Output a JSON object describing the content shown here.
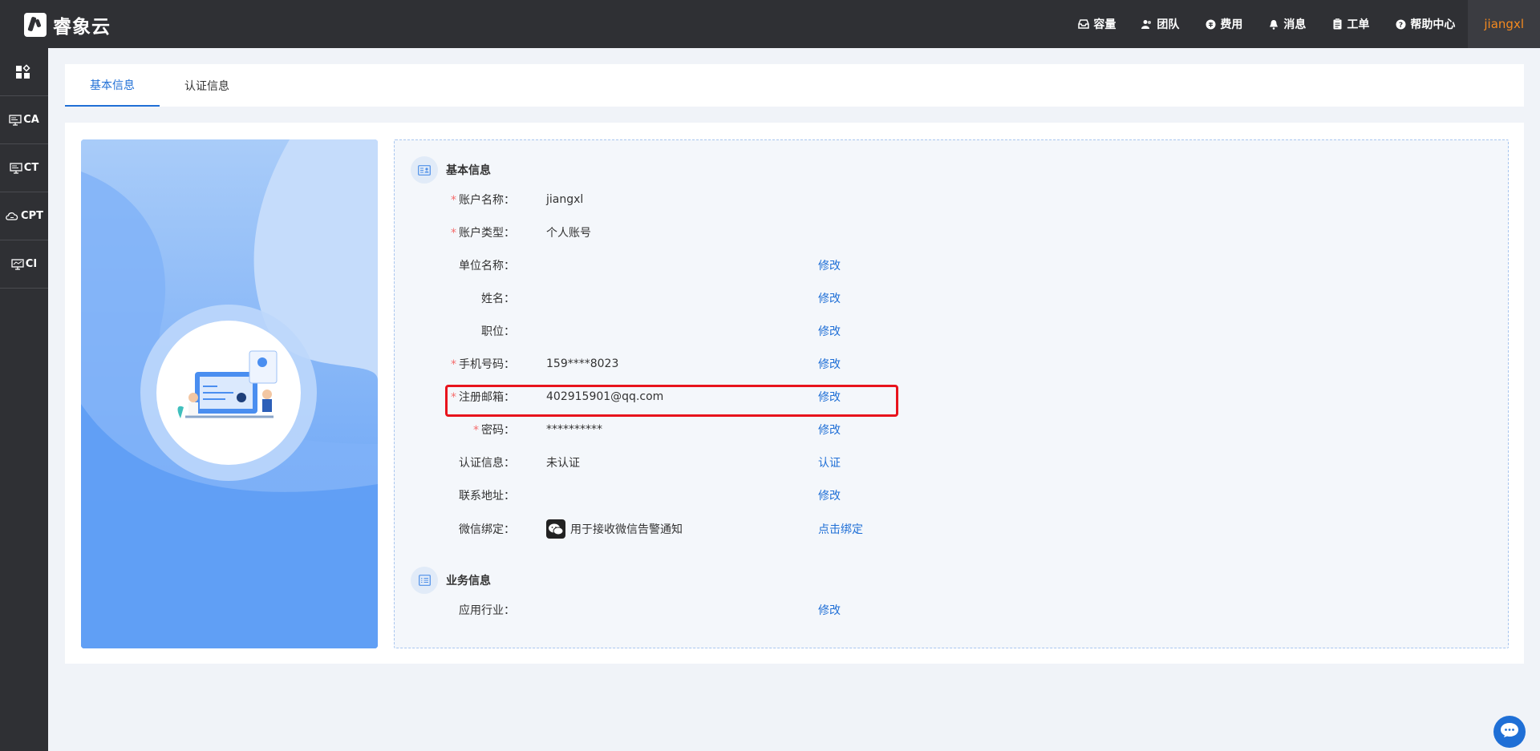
{
  "brand": {
    "name": "睿象云"
  },
  "topnav": {
    "items": [
      {
        "label": "容量",
        "icon": "inbox-icon"
      },
      {
        "label": "团队",
        "icon": "team-icon"
      },
      {
        "label": "费用",
        "icon": "currency-icon"
      },
      {
        "label": "消息",
        "icon": "bell-icon"
      },
      {
        "label": "工单",
        "icon": "clipboard-icon"
      },
      {
        "label": "帮助中心",
        "icon": "help-icon"
      }
    ],
    "user": "jiangxl"
  },
  "sidebar": {
    "items": [
      {
        "label": "",
        "icon": "dashboard-icon"
      },
      {
        "label": "CA",
        "icon": "monitor-icon"
      },
      {
        "label": "CT",
        "icon": "monitor-icon"
      },
      {
        "label": "CPT",
        "icon": "cloud-icon"
      },
      {
        "label": "CI",
        "icon": "monitor-icon"
      }
    ]
  },
  "tabs": [
    {
      "label": "基本信息",
      "active": true
    },
    {
      "label": "认证信息",
      "active": false
    }
  ],
  "basic_section": {
    "title": "基本信息"
  },
  "business_section": {
    "title": "业务信息"
  },
  "fields": [
    {
      "label": "账户名称：",
      "required": true,
      "value": "jiangxl",
      "action": ""
    },
    {
      "label": "账户类型：",
      "required": true,
      "value": "个人账号",
      "action": ""
    },
    {
      "label": "单位名称：",
      "required": false,
      "value": "",
      "action": "修改"
    },
    {
      "label": "姓名：",
      "required": false,
      "value": "",
      "action": "修改"
    },
    {
      "label": "职位：",
      "required": false,
      "value": "",
      "action": "修改"
    },
    {
      "label": "手机号码：",
      "required": true,
      "value": "159****8023",
      "action": "修改"
    },
    {
      "label": "注册邮箱：",
      "required": true,
      "value": "402915901@qq.com",
      "action": "修改"
    },
    {
      "label": "密码：",
      "required": true,
      "value": "**********",
      "action": "修改"
    },
    {
      "label": "认证信息：",
      "required": false,
      "value": "未认证",
      "action": "认证"
    },
    {
      "label": "联系地址：",
      "required": false,
      "value": "",
      "action": "修改"
    },
    {
      "label": "微信绑定：",
      "required": false,
      "value": "用于接收微信告警通知",
      "action": "点击绑定"
    }
  ],
  "business_fields": [
    {
      "label": "应用行业：",
      "required": false,
      "value": "",
      "action": "修改"
    }
  ],
  "colors": {
    "accent": "#1f6fd6",
    "user": "#f58a1f",
    "required": "#f56c6c",
    "highlight": "#e8131c"
  }
}
